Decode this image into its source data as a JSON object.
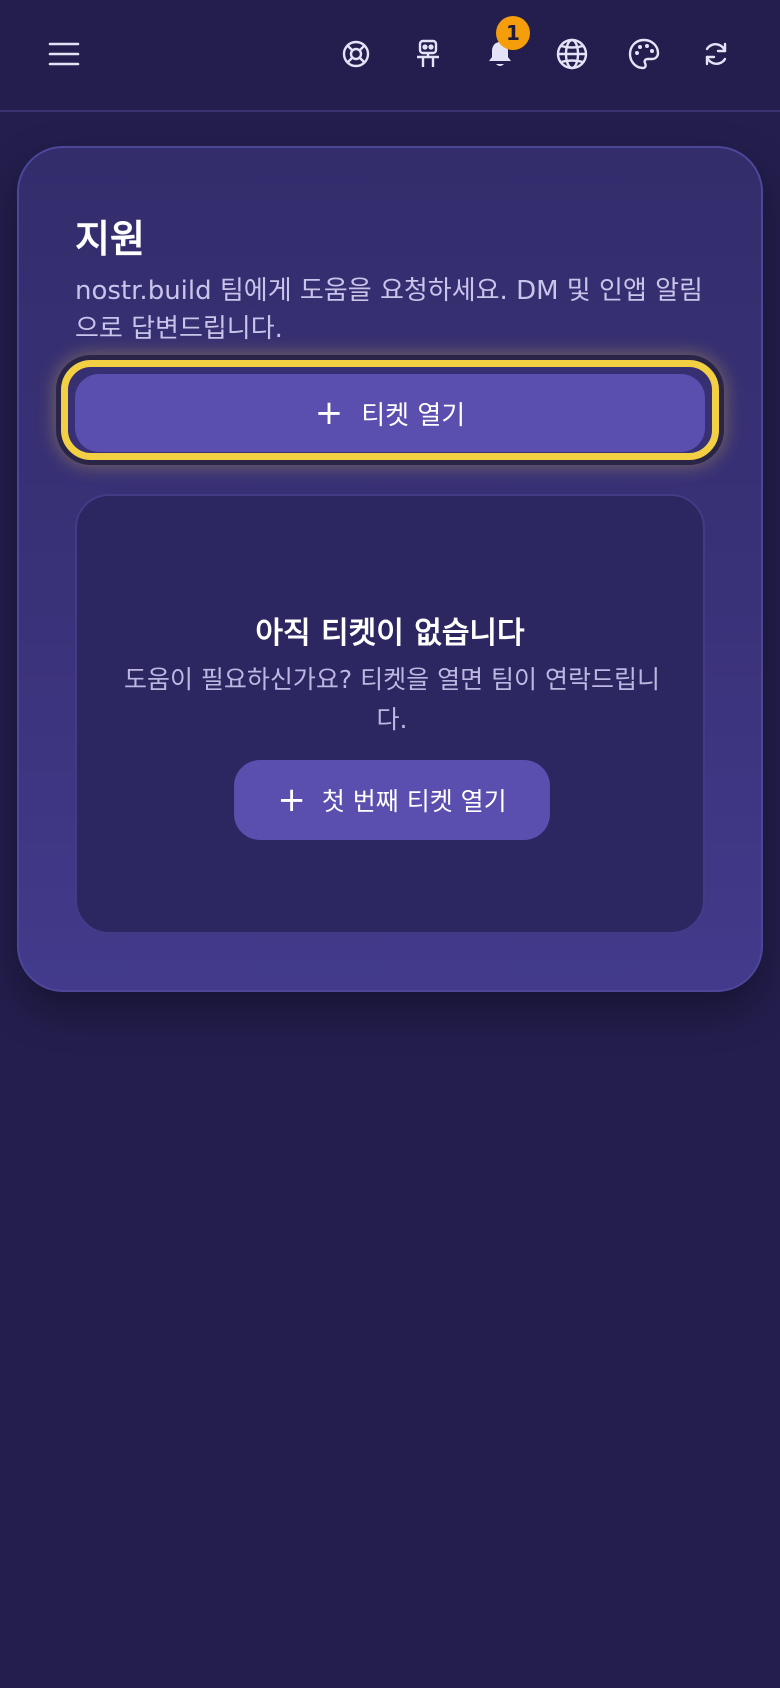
{
  "topbar": {
    "icons": [
      "menu-icon",
      "lifebuoy-icon",
      "robot-icon",
      "bell-icon",
      "globe-icon",
      "palette-icon",
      "refresh-icon"
    ],
    "notification_count": "1"
  },
  "support": {
    "title": "지원",
    "subtitle": "nostr.build 팀에게 도움을 요청하세요. DM 및 인앱 알림으로 답변드립니다.",
    "open_ticket_label": "티켓 열기",
    "empty": {
      "title": "아직 티켓이 없습니다",
      "text": "도움이 필요하신가요? 티켓을 열면 팀이 연락드립니다.",
      "first_ticket_label": "첫 번째 티켓 열기"
    }
  },
  "colors": {
    "background": "#231e4d",
    "card": "#3a3279",
    "button": "#5a4fae",
    "highlight": "#f3cf43",
    "badge": "#f59e0b"
  }
}
